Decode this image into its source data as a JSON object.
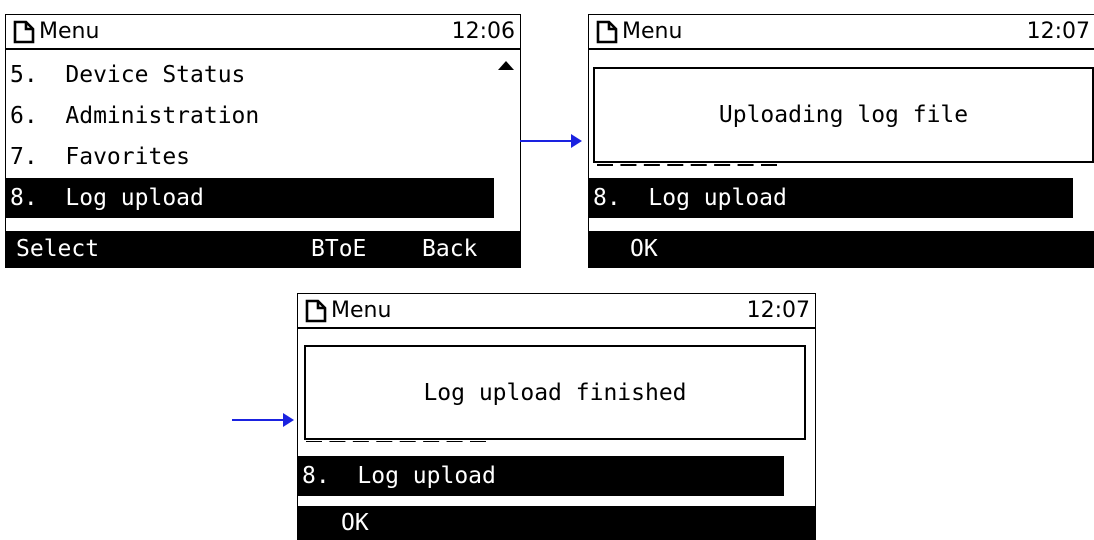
{
  "screen1": {
    "header": {
      "title": "Menu",
      "time": "12:06"
    },
    "items": [
      {
        "label": "5.  Device Status"
      },
      {
        "label": "6.  Administration"
      },
      {
        "label": "7.  Favorites"
      },
      {
        "label": "8.  Log upload"
      }
    ],
    "softkeys": {
      "left": "Select",
      "middle": "BToE",
      "right": "Back"
    }
  },
  "screen2": {
    "header": {
      "title": "Menu",
      "time": "12:07"
    },
    "popup": "Uploading log file",
    "selected_item": "8.  Log upload",
    "softkeys": {
      "left": "OK"
    }
  },
  "screen3": {
    "header": {
      "title": "Menu",
      "time": "12:07"
    },
    "popup": "Log upload finished",
    "selected_item": "8.  Log upload",
    "softkeys": {
      "left": "OK"
    }
  },
  "colors": {
    "arrow": "#1a22e0",
    "background": "#ffffff",
    "display": "#000000"
  }
}
